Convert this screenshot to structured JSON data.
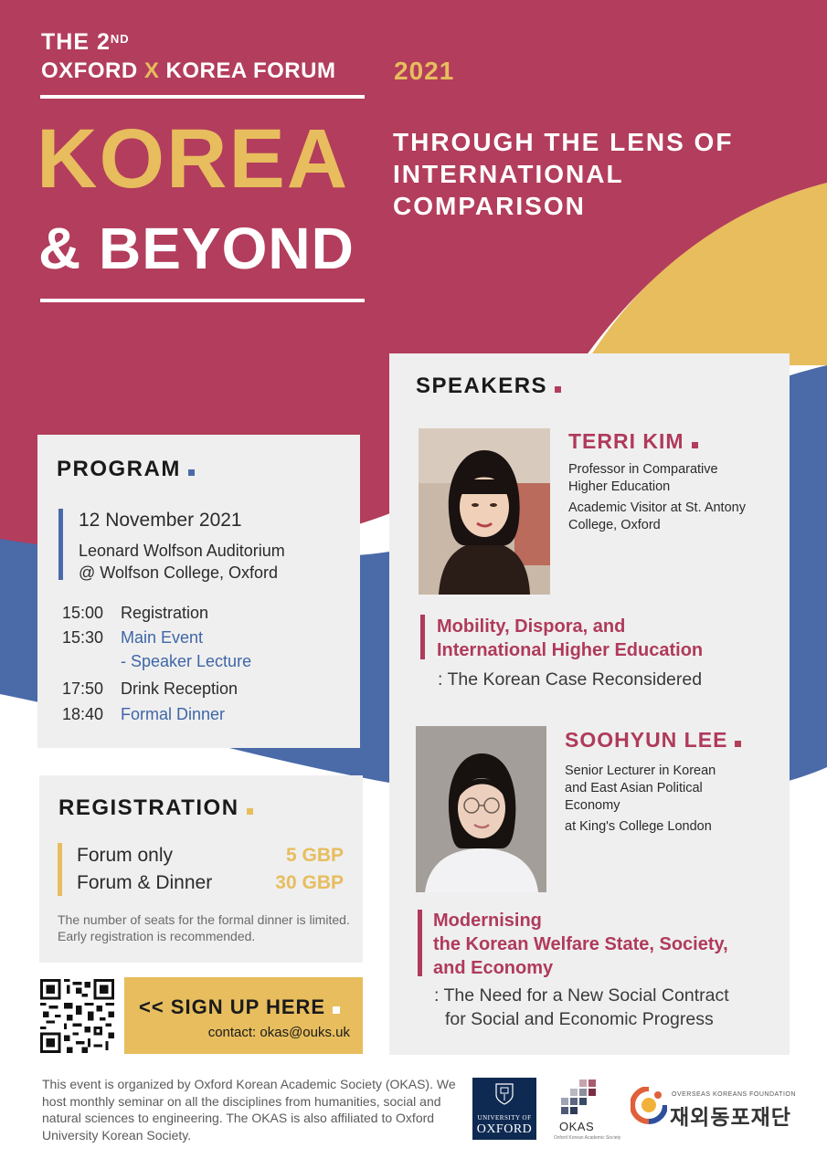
{
  "header": {
    "the": "THE 2",
    "nd": "ND",
    "forum_left": "OXFORD",
    "forum_x": "X",
    "forum_right": "KOREA FORUM",
    "year": "2021",
    "korea": "KOREA",
    "beyond": "& BEYOND",
    "lens_lines": [
      "THROUGH THE LENS OF",
      "INTERNATIONAL",
      "COMPARISON"
    ]
  },
  "program": {
    "title": "PROGRAM",
    "date": "12 November 2021",
    "venue_line1": "Leonard Wolfson Auditorium",
    "venue_line2": "@ Wolfson College, Oxford",
    "schedule": [
      {
        "time": "15:00",
        "event": "Registration"
      },
      {
        "time": "15:30",
        "event": "Main Event"
      },
      {
        "time": "",
        "event": "- Speaker Lecture"
      },
      {
        "time": "17:50",
        "event": "Drink Reception"
      },
      {
        "time": "18:40",
        "event": "Formal Dinner"
      }
    ]
  },
  "registration": {
    "title": "REGISTRATION",
    "rows": [
      {
        "label": "Forum only",
        "price": "5 GBP"
      },
      {
        "label": "Forum & Dinner",
        "price": "30 GBP"
      }
    ],
    "note": "The number of seats for the formal dinner is limited. Early registration is recommended."
  },
  "signup": {
    "label": "<< SIGN UP HERE",
    "contact": "contact: okas@ouks.uk"
  },
  "speakers": {
    "title": "SPEAKERS",
    "list": [
      {
        "name": "TERRI KIM",
        "info1": "Professor in Comparative Higher Education",
        "info2": "Academic Visitor at St. Antony College, Oxford",
        "talk_lines": [
          "Mobility, Dispora, and",
          "International Higher Education"
        ],
        "talk_sub_lines": [
          ": The Korean Case Reconsidered"
        ]
      },
      {
        "name": "SOOHYUN LEE",
        "info1": "Senior Lecturer in Korean and East Asian Political Economy",
        "info2": "at King's College London",
        "talk_lines": [
          "Modernising",
          "the Korean Welfare State, Society,",
          "and Economy"
        ],
        "talk_sub_lines": [
          ": The Need for a New Social Contract",
          "for Social and Economic Progress"
        ]
      }
    ]
  },
  "footer": {
    "text": "This event is organized by Oxford Korean Academic Society (OKAS). We host monthly seminar on all the disciplines from humanities, social and natural sciences to engineering. The OKAS is also affiliated to Oxford University Korean Society.",
    "oxford_line1": "UNIVERSITY OF",
    "oxford_line2": "OXFORD",
    "okas": "OKAS",
    "okas_sub": "Oxford Korean Academic Society",
    "okf_en": "OVERSEAS KOREANS FOUNDATION",
    "okf_kr": "재외동포재단"
  },
  "colors": {
    "crimson": "#b33d5c",
    "gold": "#e7bd5e",
    "blue": "#4a6aa8",
    "panel": "#efefef"
  }
}
